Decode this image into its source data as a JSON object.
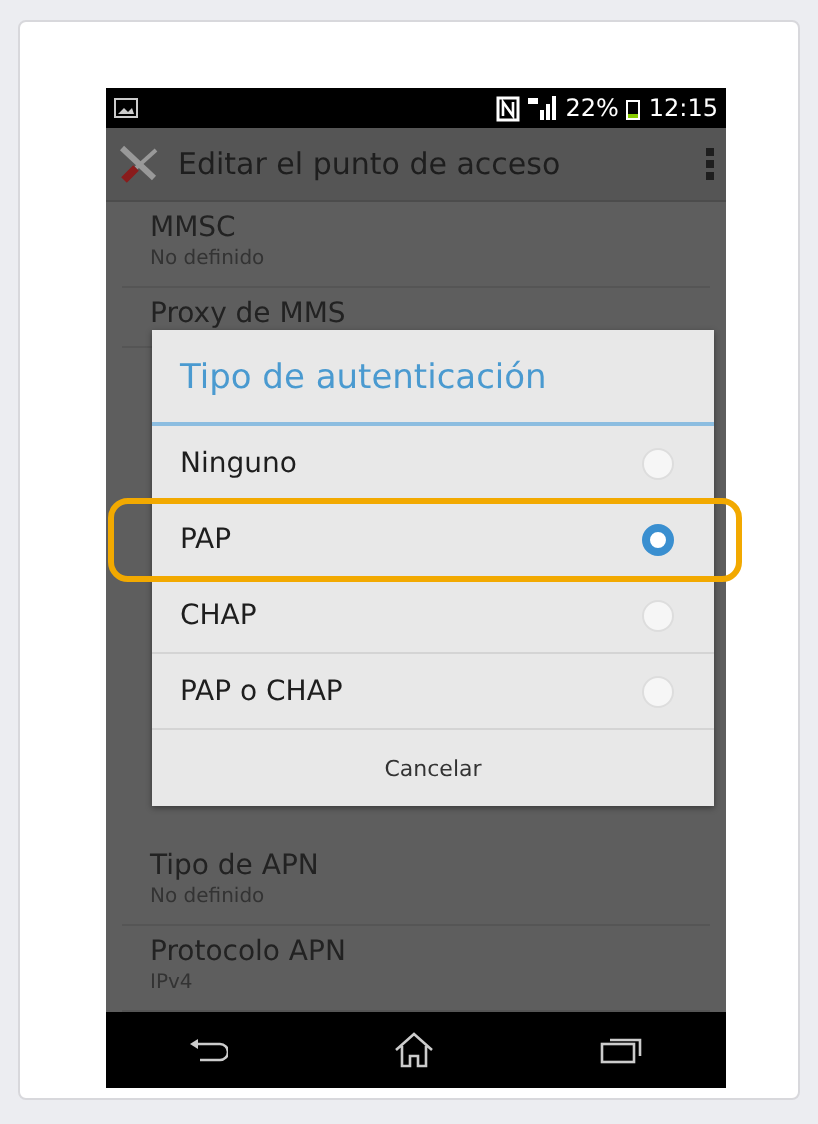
{
  "status_bar": {
    "battery": "22%",
    "time": "12:15"
  },
  "action_bar": {
    "title": "Editar el punto de acceso"
  },
  "settings_above": [
    {
      "title": "MMSC",
      "value": "No definido"
    },
    {
      "title": "Proxy de MMS"
    }
  ],
  "settings_below": [
    {
      "title": "Tipo de APN",
      "value": "No definido"
    },
    {
      "title": "Protocolo APN",
      "value": "IPv4"
    }
  ],
  "dialog": {
    "title": "Tipo de autenticación",
    "options": [
      {
        "label": "Ninguno",
        "selected": false,
        "highlighted": false
      },
      {
        "label": "PAP",
        "selected": true,
        "highlighted": true
      },
      {
        "label": "CHAP",
        "selected": false,
        "highlighted": false
      },
      {
        "label": "PAP o CHAP",
        "selected": false,
        "highlighted": false
      }
    ],
    "cancel": "Cancelar"
  }
}
